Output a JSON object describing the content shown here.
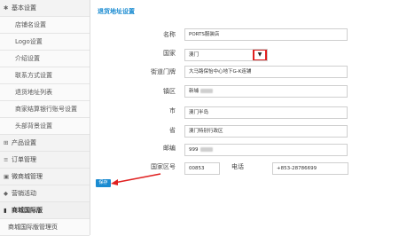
{
  "sidebar": {
    "items": [
      {
        "label": "基本设置",
        "icon": "gear-icon",
        "glyph": "✱",
        "type": "top"
      },
      {
        "label": "店铺名设置",
        "type": "sub"
      },
      {
        "label": "Logo设置",
        "type": "sub"
      },
      {
        "label": "介绍设置",
        "type": "sub"
      },
      {
        "label": "联系方式设置",
        "type": "sub"
      },
      {
        "label": "退货地址列表",
        "type": "sub"
      },
      {
        "label": "商家结算银行账号设置",
        "type": "sub"
      },
      {
        "label": "头部背景设置",
        "type": "sub"
      },
      {
        "label": "产品设置",
        "icon": "product-icon",
        "glyph": "⊞",
        "type": "top"
      },
      {
        "label": "订单管理",
        "icon": "order-icon",
        "glyph": "≡",
        "type": "top"
      },
      {
        "label": "微商城管理",
        "icon": "shop-icon",
        "glyph": "▣",
        "type": "top"
      },
      {
        "label": "营销活动",
        "icon": "megaphone-icon",
        "glyph": "◆",
        "type": "top"
      },
      {
        "label": "商城国际版",
        "icon": "bookmark-icon",
        "glyph": "▮",
        "type": "bold"
      },
      {
        "label": "商城国际版管理页",
        "type": "top-noicon"
      }
    ]
  },
  "main": {
    "title": "退货地址设置",
    "fields": {
      "name": {
        "label": "名称",
        "value": "PORTS服装店"
      },
      "country": {
        "label": "国家",
        "value": "澳门",
        "arrow": "▼"
      },
      "street": {
        "label": "街道门牌",
        "value": "大马路保怡中心地下G-K连铺"
      },
      "town": {
        "label": "镇区",
        "value": "新埔"
      },
      "city": {
        "label": "市",
        "value": "澳门半岛"
      },
      "province": {
        "label": "省",
        "value": "澳门特别行政区"
      },
      "postal": {
        "label": "邮编",
        "value": "999"
      },
      "country_code": {
        "label": "国家区号",
        "value": "00853"
      },
      "phone": {
        "label": "电话",
        "value": "+853-28786699"
      }
    },
    "save_label": "保存"
  },
  "colors": {
    "accent": "#1a8bd1",
    "highlight": "#e02020"
  }
}
